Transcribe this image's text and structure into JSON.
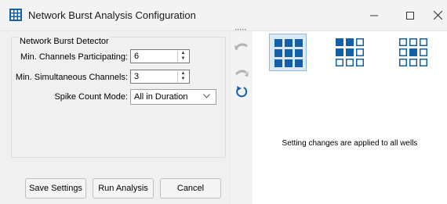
{
  "window": {
    "title": "Network Burst Analysis Configuration",
    "controls": [
      "minimize",
      "maximize",
      "close"
    ]
  },
  "group": {
    "label": "Network Burst Detector",
    "fields": [
      {
        "label": "Min. Channels Participating:",
        "value": "6"
      },
      {
        "label": "Min. Simultaneous Channels:",
        "value": "3"
      }
    ],
    "spike_mode": {
      "label": "Spike Count Mode:",
      "value": "All in Duration"
    }
  },
  "buttons": {
    "save": "Save Settings",
    "run": "Run Analysis",
    "cancel": "Cancel"
  },
  "toolbar": {
    "icons": [
      "undo-icon",
      "redo-icon",
      "reset-icon"
    ]
  },
  "layouts": {
    "options": [
      "grid-full-icon",
      "grid-top-left-icon",
      "grid-center-icon"
    ],
    "selected": "grid-full-icon"
  },
  "note": "Setting changes are applied to all wells",
  "colors": {
    "accent_blue": "#1460a8",
    "panel_gray": "#f0f0f0",
    "selection_bg": "#dbe9f7"
  }
}
